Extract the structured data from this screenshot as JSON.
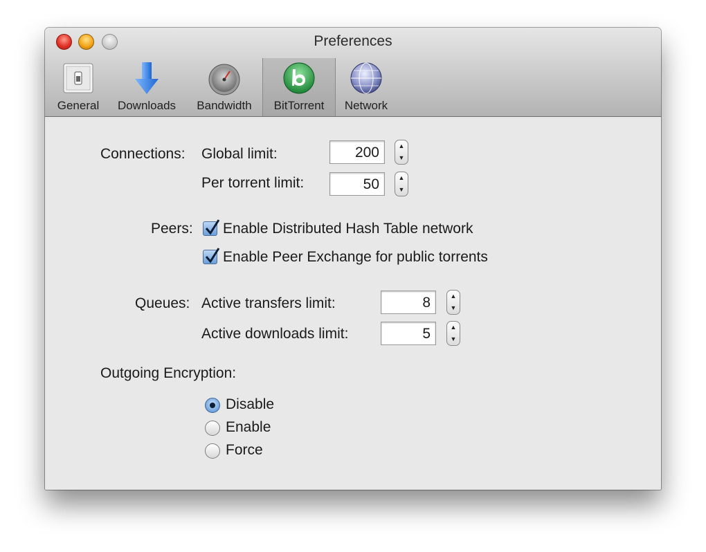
{
  "window": {
    "title": "Preferences"
  },
  "toolbar": {
    "items": [
      {
        "label": "General",
        "icon": "switch-icon"
      },
      {
        "label": "Downloads",
        "icon": "download-arrow-icon"
      },
      {
        "label": "Bandwidth",
        "icon": "gauge-icon"
      },
      {
        "label": "BitTorrent",
        "icon": "bittorrent-icon",
        "selected": true
      },
      {
        "label": "Network",
        "icon": "globe-icon"
      }
    ]
  },
  "connections": {
    "section_label": "Connections:",
    "global_limit_label": "Global limit:",
    "global_limit_value": "200",
    "per_torrent_label": "Per torrent limit:",
    "per_torrent_value": "50"
  },
  "peers": {
    "section_label": "Peers:",
    "dht_label": "Enable Distributed Hash Table network",
    "dht_checked": true,
    "pex_label": "Enable Peer Exchange for public torrents",
    "pex_checked": true
  },
  "queues": {
    "section_label": "Queues:",
    "active_transfers_label": "Active transfers limit:",
    "active_transfers_value": "8",
    "active_downloads_label": "Active downloads limit:",
    "active_downloads_value": "5"
  },
  "encryption": {
    "section_label": "Outgoing Encryption:",
    "options": [
      {
        "label": "Disable",
        "selected": true
      },
      {
        "label": "Enable",
        "selected": false
      },
      {
        "label": "Force",
        "selected": false
      }
    ]
  },
  "colors": {
    "accent": "#5b93d6",
    "bittorrent_green": "#1e9a3c",
    "download_blue": "#2f7fe0"
  }
}
